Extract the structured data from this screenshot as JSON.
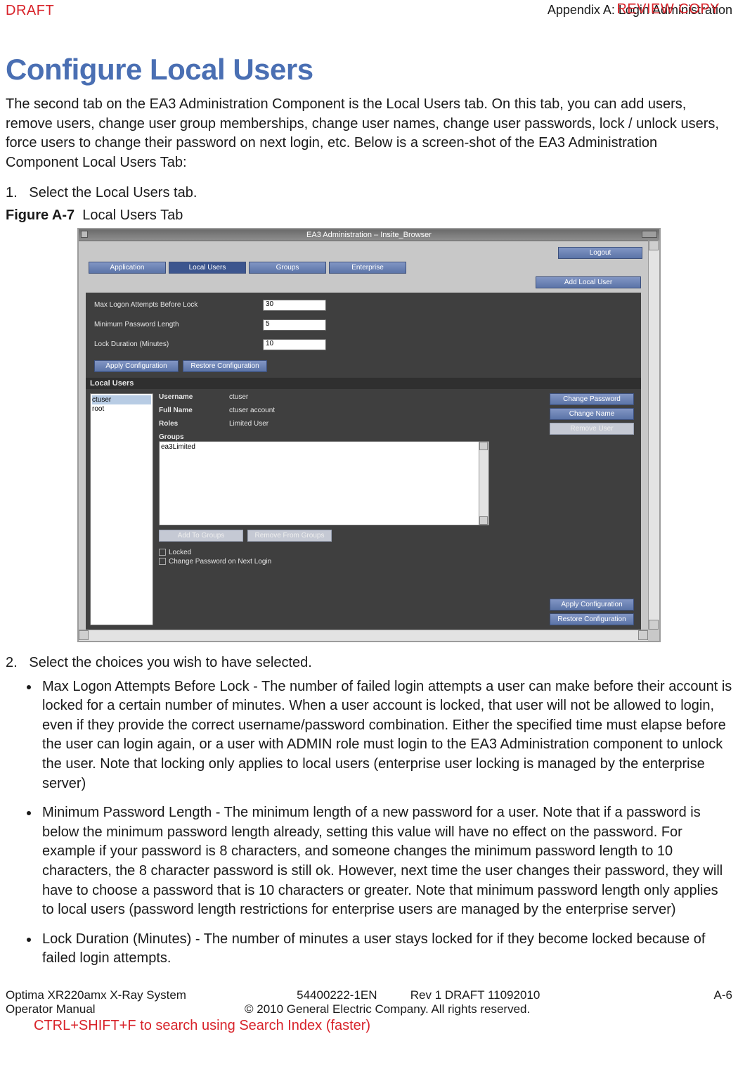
{
  "header": {
    "draft": "DRAFT",
    "review": "REVIEW COPY",
    "appendix": "Appendix A: Login Administration"
  },
  "title": "Configure Local Users",
  "intro": "The second tab on the EA3 Administration Component is the Local Users tab. On this tab, you can add users, remove users, change user group memberships, change user names, change user passwords, lock / unlock users, force users to change their password on next login, etc. Below is a screen-shot of the EA3 Administration Component Local Users Tab:",
  "step1": "Select the Local Users tab.",
  "figure": {
    "label": "Figure A-7",
    "caption": "Local Users Tab"
  },
  "screenshot": {
    "window_title": "EA3 Administration – Insite_Browser",
    "logout": "Logout",
    "tabs": {
      "app": "Application",
      "local": "Local Users",
      "groups": "Groups",
      "enterprise": "Enterprise"
    },
    "add_user": "Add Local User",
    "config": {
      "max_attempts_label": "Max Logon Attempts Before Lock",
      "max_attempts_value": "30",
      "min_pw_label": "Minimum Password Length",
      "min_pw_value": "5",
      "lock_dur_label": "Lock Duration (Minutes)",
      "lock_dur_value": "10",
      "apply": "Apply Configuration",
      "restore": "Restore Configuration"
    },
    "local_users_header": "Local Users",
    "userlist": {
      "u1": "ctuser",
      "u2": "root"
    },
    "details": {
      "username_label": "Username",
      "username_val": "ctuser",
      "fullname_label": "Full Name",
      "fullname_val": "ctuser account",
      "roles_label": "Roles",
      "roles_val": "Limited User",
      "change_pw": "Change Password",
      "change_name": "Change Name",
      "remove_user": "Remove User",
      "groups_label": "Groups",
      "group_item": "ea3Limited",
      "add_to_groups": "Add To Groups",
      "remove_from_groups": "Remove From Groups",
      "locked": "Locked",
      "change_next": "Change Password on Next Login",
      "apply2": "Apply Configuration",
      "restore2": "Restore Configuration"
    }
  },
  "step2": "Select the choices you wish to have selected.",
  "bullets": {
    "b1": "Max Logon Attempts Before Lock - The number of failed login attempts a user can make before their account is locked for a certain number of minutes. When a user account is locked, that user will not be allowed to login, even if they provide the correct username/password combination. Either the specified time must elapse before the user can login again, or a user with ADMIN role must login to the EA3 Administration component to unlock the user. Note that locking only applies to local users (enterprise user locking is managed by the enterprise server)",
    "b2": "Minimum Password Length - The minimum length of a new password for a user. Note that if a password is below the minimum password length already, setting this value will have no effect on the password. For example if your password is 8 characters, and someone changes the minimum password length to 10 characters, the 8 character password is still ok. However, next time the user changes their password, they will have to choose a password that is 10 characters or greater. Note that minimum password length only applies to local users (password length restrictions for enterprise users are managed by the enterprise server)",
    "b3": "Lock Duration (Minutes) - The number of minutes a user stays locked for if they become locked because of failed login attempts."
  },
  "footer": {
    "product": "Optima XR220amx X-Ray System",
    "doc": "54400222-1EN",
    "rev": "Rev 1 DRAFT 11092010",
    "page": "A-6",
    "manual": "Operator Manual",
    "copyright": "© 2010 General Electric Company. All rights reserved.",
    "hint": "CTRL+SHIFT+F to search using Search Index (faster)"
  }
}
